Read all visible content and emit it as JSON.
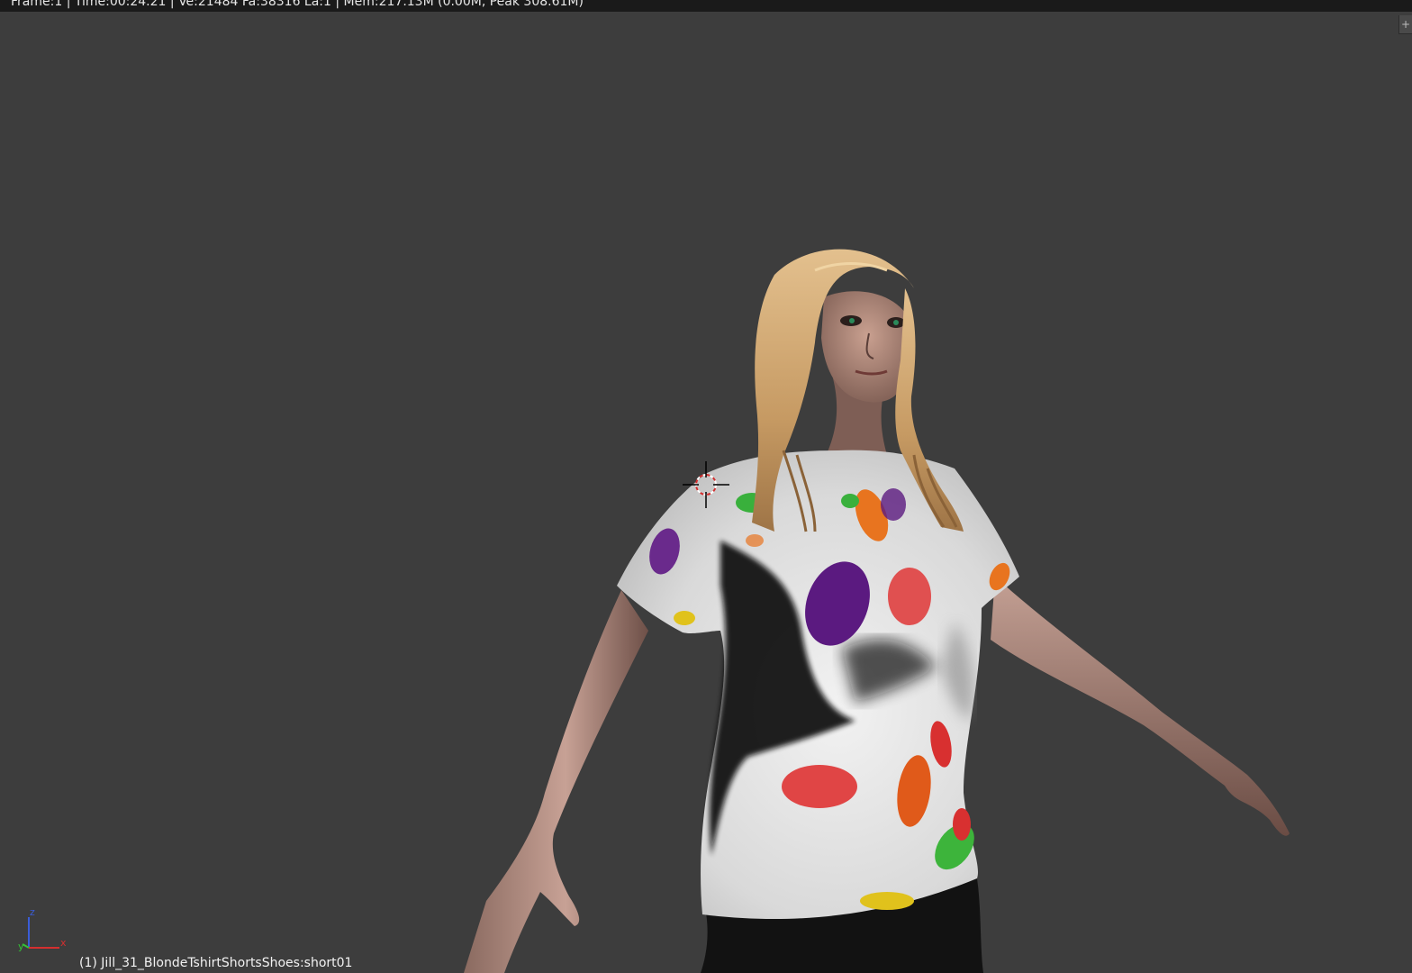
{
  "status_bar": {
    "text": "Frame:1 | Time:00:24.21 | Ve:21484 Fa:38316 La:1 | Mem:217.13M (0.00M, Peak 308.61M)"
  },
  "viewport": {
    "background_color": "#3d3d3d",
    "object_info": "(1) Jill_31_BlondeTshirtShortsShoes:short01",
    "axis_labels": {
      "x": "x",
      "y": "y",
      "z": "z"
    },
    "corner_widget_symbol": "+",
    "axis_colors": {
      "x": "#d42f2f",
      "y": "#35c235",
      "z": "#3a5dd8"
    }
  },
  "icons": {
    "cursor": "3d-cursor-icon",
    "gizmo": "axis-gizmo-icon",
    "corner": "split-area-icon"
  }
}
